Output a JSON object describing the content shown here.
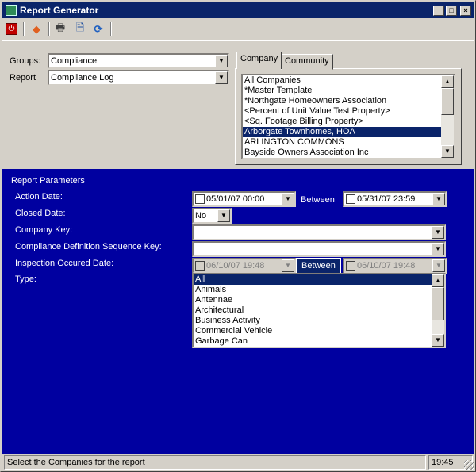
{
  "window": {
    "title": "Report Generator",
    "controls": {
      "minimize": "_",
      "maximize": "□",
      "close": "×"
    }
  },
  "toolbar": {
    "items": [
      {
        "name": "power-icon",
        "glyph": "⏻"
      },
      {
        "name": "run-report-icon",
        "glyph": "◆"
      },
      {
        "name": "print-icon",
        "glyph": "🖶"
      },
      {
        "name": "preview-icon",
        "glyph": "🗎"
      },
      {
        "name": "refresh-icon",
        "glyph": "⟳"
      }
    ]
  },
  "selection": {
    "groups_label": "Groups:",
    "groups_value": "Compliance",
    "report_label": "Report",
    "report_value": "Compliance Log"
  },
  "tabs": [
    {
      "label": "Company",
      "active": true
    },
    {
      "label": "Community",
      "active": false
    }
  ],
  "companies": {
    "items": [
      "All Companies",
      "*Master Template",
      "*Northgate Homeowners Association",
      "<Percent of Unit Value Test Property>",
      "<Sq. Footage Billing Property>",
      "Arborgate Townhomes, HOA",
      "ARLINGTON COMMONS",
      "Bayside Owners Association Inc"
    ],
    "selected_index": 5
  },
  "params": {
    "header": "Report Parameters",
    "action_date_label": "Action Date:",
    "action_date_from": "05/01/07 00:00",
    "action_between": "Between",
    "action_date_to": "05/31/07 23:59",
    "closed_date_label": "Closed Date:",
    "closed_date_value": "No",
    "company_key_label": "Company Key:",
    "company_key_value": "",
    "cdsk_label": "Compliance Definition Sequence Key:",
    "cdsk_value": "",
    "inspection_label": "Inspection Occured Date:",
    "inspection_from": "06/10/07 19:48",
    "inspection_between": "Between",
    "inspection_to": "06/10/07 19:48",
    "type_label": "Type:",
    "type_items": [
      "All",
      "Animals",
      "Antennae",
      "Architectural",
      "Business Activity",
      "Commercial Vehicle",
      "Garbage Can"
    ],
    "type_selected_index": 0
  },
  "status": {
    "message": "Select the Companies for the report",
    "time": "19:45"
  },
  "colors": {
    "title_bar": "#0a246a",
    "params_bg": "#0000a0",
    "selection": "#0a246a"
  }
}
